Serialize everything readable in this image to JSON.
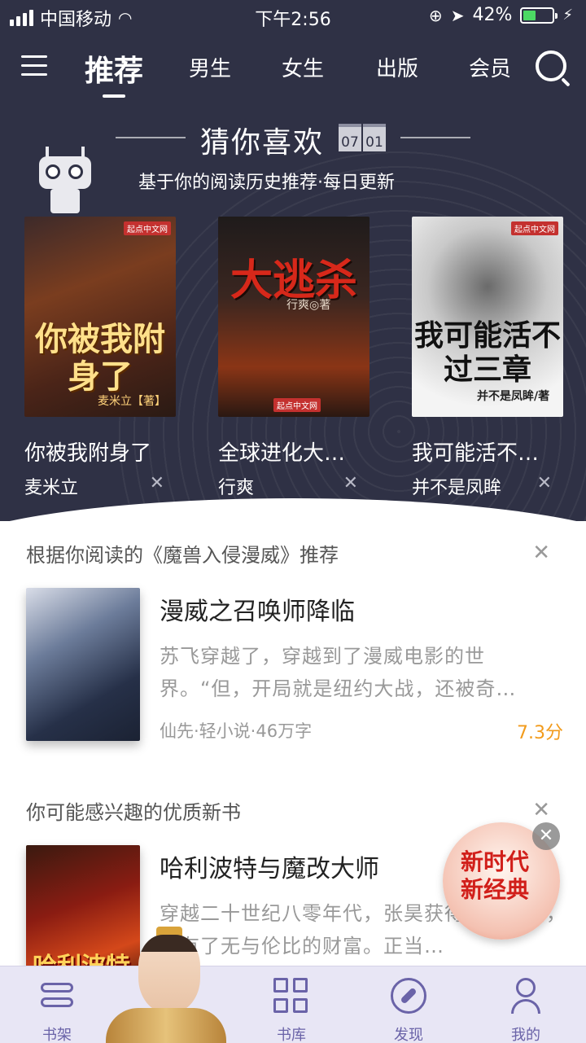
{
  "status_bar": {
    "carrier": "中国移动",
    "time": "下午2:56",
    "battery": "42%",
    "battery_level": 0.42
  },
  "nav": {
    "tabs": [
      "推荐",
      "男生",
      "女生",
      "出版",
      "会员"
    ],
    "active": "推荐"
  },
  "guess": {
    "title": "猜你喜欢",
    "date_month": "07",
    "date_day": "01",
    "subtitle": "基于你的阅读历史推荐·每日更新",
    "books": [
      {
        "cover_title": "你被我附身了",
        "cover_author": "麦米立【著】",
        "title": "你被我附身了",
        "author": "麦米立"
      },
      {
        "cover_title": "大逃杀",
        "cover_author": "行爽◎著",
        "title": "全球进化大…",
        "author": "行爽"
      },
      {
        "cover_title": "我可能活不过三章",
        "cover_author": "并不是凤眸/著",
        "title": "我可能活不…",
        "author": "并不是凤眸"
      }
    ],
    "publisher_tag": "起点中文网"
  },
  "section1": {
    "heading": "根据你阅读的《魔兽入侵漫威》推荐",
    "book": {
      "title": "漫威之召唤师降临",
      "desc": "苏飞穿越了，穿越到了漫威电影的世界。“但，开局就是纽约大战，还被奇…",
      "meta": "仙先·轻小说·46万字",
      "score": "7.3分"
    }
  },
  "section2": {
    "heading": "你可能感兴趣的优质新书",
    "book": {
      "title": "哈利波特与魔改大师",
      "cover_title": "哈利波特",
      "desc": "穿越二十世纪八零年代，张昊获得了金手指，拥有了无与伦比的财富。正当…"
    }
  },
  "promo": {
    "text": "新时代新经典"
  },
  "tabbar": [
    {
      "label": "书架",
      "icon": "bookshelf-icon"
    },
    {
      "label": "书库",
      "icon": "grid-icon"
    },
    {
      "label": "发现",
      "icon": "compass-icon"
    },
    {
      "label": "我的",
      "icon": "user-icon"
    }
  ]
}
